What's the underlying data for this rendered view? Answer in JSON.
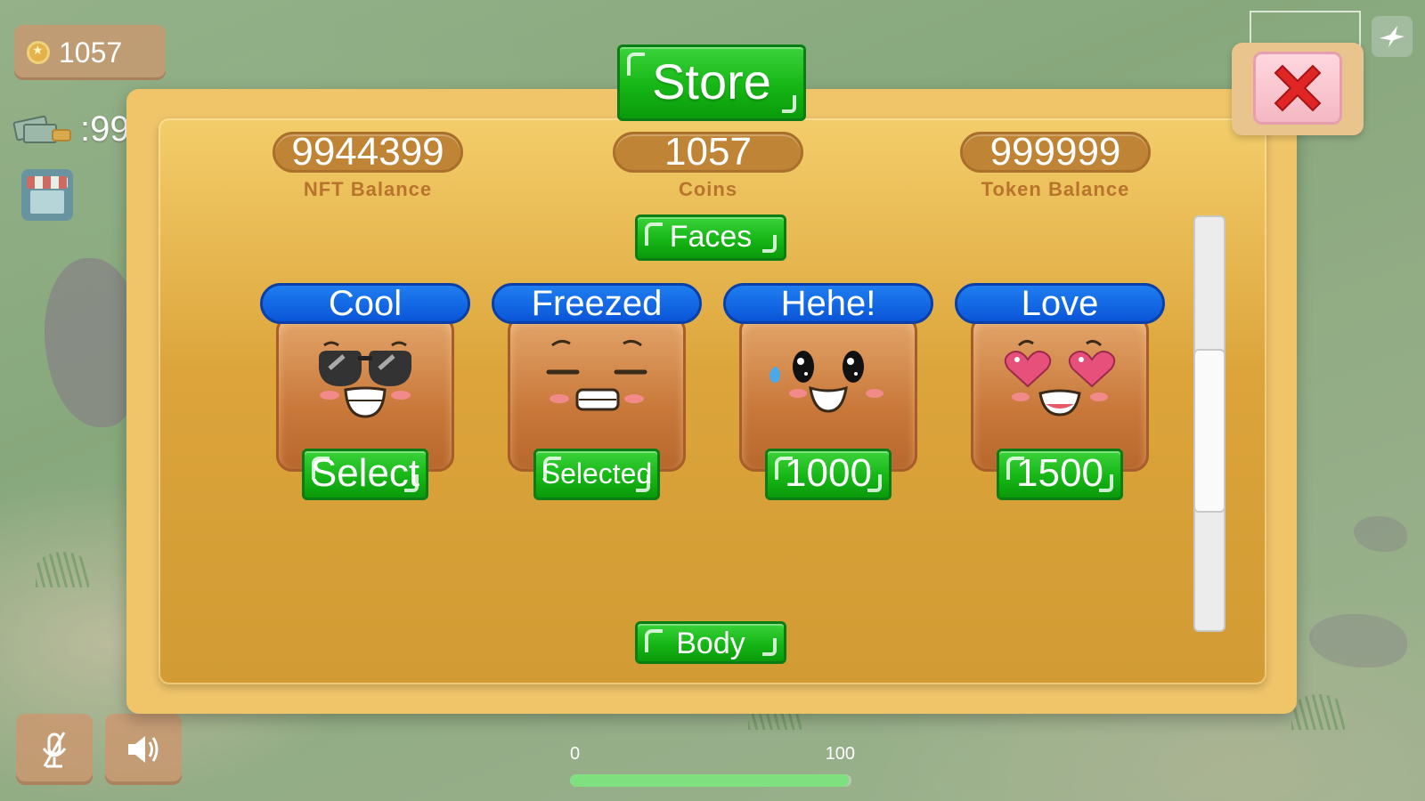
{
  "hud": {
    "coins": "1057",
    "tokens_partial": ":99",
    "icons": [
      "coin-icon",
      "cash-stack-icon",
      "shop-icon",
      "bird-icon",
      "mic-off-icon",
      "speaker-icon"
    ]
  },
  "progress": {
    "min_label": "0",
    "max_label": "100",
    "fill_fraction": 0.99,
    "fill_color": "#7fe07f"
  },
  "store": {
    "title": "Store",
    "balances": [
      {
        "value": "9944399",
        "label": "NFT Balance"
      },
      {
        "value": "1057",
        "label": "Coins"
      },
      {
        "value": "999999",
        "label": "Token Balance"
      }
    ],
    "sections": {
      "faces": "Faces",
      "body": "Body"
    },
    "items": [
      {
        "name": "Cool",
        "action": "Select",
        "face": "sunglasses-face-icon"
      },
      {
        "name": "Freezed",
        "action": "Selected",
        "face": "grimace-face-icon"
      },
      {
        "name": "Hehe!",
        "action": "1000",
        "face": "sweat-smile-face-icon"
      },
      {
        "name": "Love",
        "action": "1500",
        "face": "heart-eyes-face-icon"
      }
    ]
  },
  "colors": {
    "green_button": "#16b616",
    "blue_label": "#0a55d8",
    "panel": "#dca43b",
    "balance_pill": "#c08436",
    "close_button": "#f4b7c3"
  }
}
